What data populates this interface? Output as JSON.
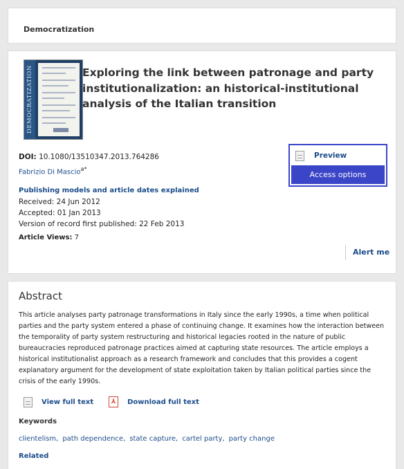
{
  "journal": {
    "name": "Democratization"
  },
  "article": {
    "cover_spine_text": "DEMOCRATIZATION",
    "title": "Exploring the link between patronage and party institutionalization: an historical-institutional analysis of the Italian transition",
    "doi_label": "DOI:",
    "doi_value": "10.1080/13510347.2013.764286",
    "author": "Fabrizio Di Mascio",
    "author_sup": "a*",
    "dates_link": "Publishing models and article dates explained",
    "received": "Received: 24 Jun 2012",
    "accepted": "Accepted: 01 Jan 2013",
    "version_of_record": "Version of record first published: 22 Feb 2013",
    "views_label": "Article Views:",
    "views_value": "7",
    "preview_label": "Preview",
    "access_options_label": "Access options",
    "alert_me_label": "Alert me"
  },
  "abstract": {
    "heading": "Abstract",
    "text": "This article analyses party patronage transformations in Italy since the early 1990s, a time when political parties and the party system entered a phase of continuing change. It examines how the interaction between the temporality of party system restructuring and historical legacies rooted in the nature of public bureaucracies reproduced patronage practices aimed at capturing state resources. The article employs a historical institutionalist approach as a research framework and concludes that this provides a cogent explanatory argument for the development of state exploitation taken by Italian political parties since the crisis of the early 1990s.",
    "view_full_text": "View full text",
    "download_full_text": "Download full text",
    "keywords_heading": "Keywords",
    "keywords": [
      "clientelism,",
      "path dependence,",
      "state capture,",
      "cartel party,",
      "party change"
    ],
    "related_heading": "Related"
  },
  "icons": {
    "preview": "document-icon",
    "view_full_text": "document-icon",
    "download_full_text": "pdf-icon"
  },
  "colors": {
    "link": "#1b4c8a",
    "access_button": "#3b45c8",
    "background": "#e9e9e9"
  }
}
